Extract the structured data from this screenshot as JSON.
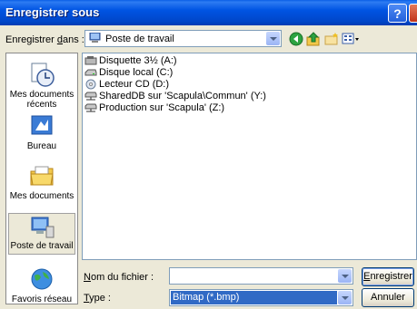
{
  "window": {
    "title": "Enregistrer sous",
    "help_label": "?"
  },
  "save_in": {
    "label_pre": "Enregistrer ",
    "label_key": "d",
    "label_post": "ans :",
    "value": "Poste de travail"
  },
  "places": [
    {
      "label": "Mes documents récents",
      "icon": "recent-documents-icon"
    },
    {
      "label": "Bureau",
      "icon": "desktop-icon"
    },
    {
      "label": "Mes documents",
      "icon": "my-documents-icon"
    },
    {
      "label": "Poste de travail",
      "icon": "my-computer-icon",
      "selected": true
    },
    {
      "label": "Favoris réseau",
      "icon": "network-places-icon"
    }
  ],
  "files": [
    {
      "name": "Disquette 3½ (A:)",
      "icon": "floppy-drive-icon"
    },
    {
      "name": "Disque local (C:)",
      "icon": "local-disk-icon"
    },
    {
      "name": "Lecteur CD (D:)",
      "icon": "cd-drive-icon"
    },
    {
      "name": "SharedDB sur 'Scapula\\Commun' (Y:)",
      "icon": "network-drive-icon"
    },
    {
      "name": "Production sur 'Scapula' (Z:)",
      "icon": "network-drive-icon"
    }
  ],
  "filename": {
    "label_key": "N",
    "label_rest": "om du fichier :",
    "value": ""
  },
  "filetype": {
    "label_key": "T",
    "label_rest": "ype :",
    "value": "Bitmap (*.bmp)"
  },
  "buttons": {
    "save_key": "E",
    "save_rest": "nregistrer",
    "cancel": "Annuler"
  },
  "colors": {
    "titlebar": "#0054e3",
    "selection": "#316ac5",
    "dialog_bg": "#ece9d8"
  }
}
